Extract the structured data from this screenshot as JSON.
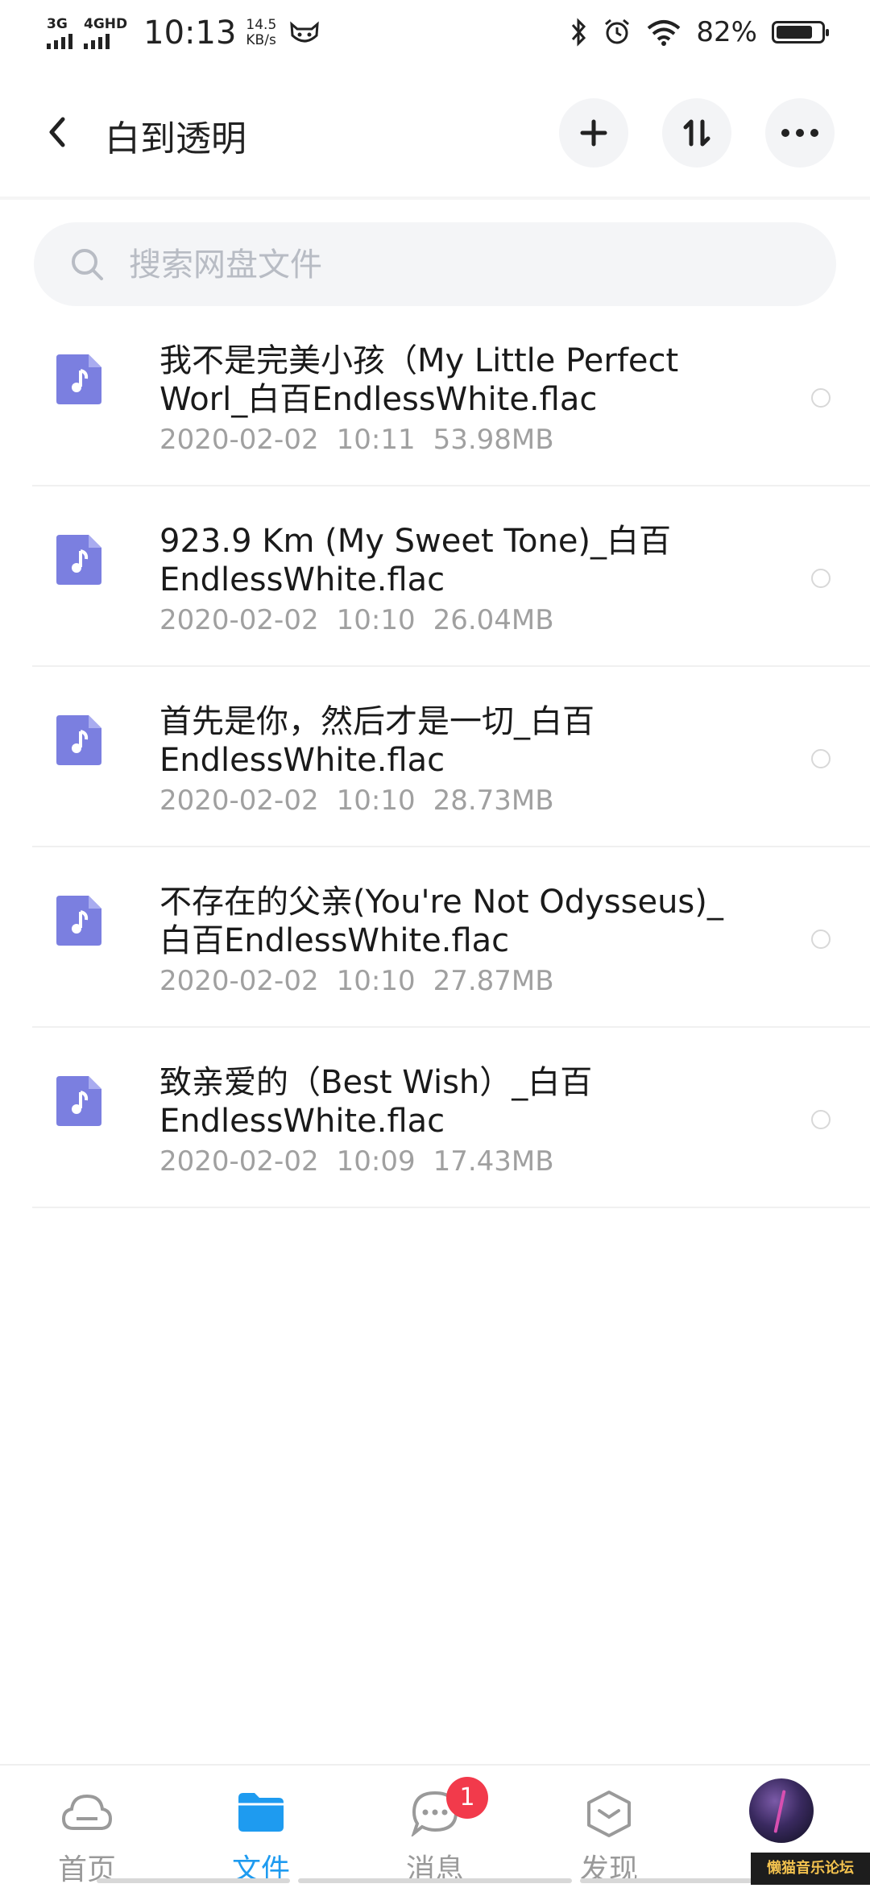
{
  "status_bar": {
    "net1": "3G",
    "net2": "4GHD",
    "time": "10:13",
    "speed_value": "14.5",
    "speed_unit": "KB/s",
    "battery_percent": "82%",
    "battery_level": 0.82,
    "icons": [
      "signal-icon",
      "cat-face-icon",
      "bluetooth-icon",
      "alarm-icon",
      "wifi-icon",
      "battery-icon"
    ]
  },
  "header": {
    "title": "白到透明",
    "actions": [
      "add-icon",
      "sort-icon",
      "more-icon"
    ]
  },
  "search": {
    "placeholder": "搜索网盘文件"
  },
  "files": [
    {
      "name_line1": "我不是完美小孩（My Little Perfect",
      "name_line2": "Worl_白百EndlessWhite.flac",
      "date": "2020-02-02",
      "time": "10:11",
      "size": "53.98MB"
    },
    {
      "name_line1": "923.9 Km (My Sweet Tone)_白百",
      "name_line2": "EndlessWhite.flac",
      "date": "2020-02-02",
      "time": "10:10",
      "size": "26.04MB"
    },
    {
      "name_line1": "首先是你，然后才是一切_白百",
      "name_line2": "EndlessWhite.flac",
      "date": "2020-02-02",
      "time": "10:10",
      "size": "28.73MB"
    },
    {
      "name_line1": "不存在的父亲(You're Not Odysseus)_",
      "name_line2": "白百EndlessWhite.flac",
      "date": "2020-02-02",
      "time": "10:10",
      "size": "27.87MB"
    },
    {
      "name_line1": "致亲爱的（Best Wish）_白百",
      "name_line2": "EndlessWhite.flac",
      "date": "2020-02-02",
      "time": "10:09",
      "size": "17.43MB"
    }
  ],
  "bottom_nav": {
    "items": [
      {
        "label": "首页",
        "icon": "cloud-icon"
      },
      {
        "label": "文件",
        "icon": "folder-icon"
      },
      {
        "label": "消息",
        "icon": "message-icon"
      },
      {
        "label": "发现",
        "icon": "discover-icon"
      }
    ],
    "active_index": 1,
    "message_badge": "1"
  },
  "watermark": "懒猫音乐论坛",
  "colors": {
    "accent": "#1e9bf0",
    "file_icon": "#7b7fe0",
    "badge": "#f23a4b",
    "meta_text": "#a0a0a0"
  }
}
